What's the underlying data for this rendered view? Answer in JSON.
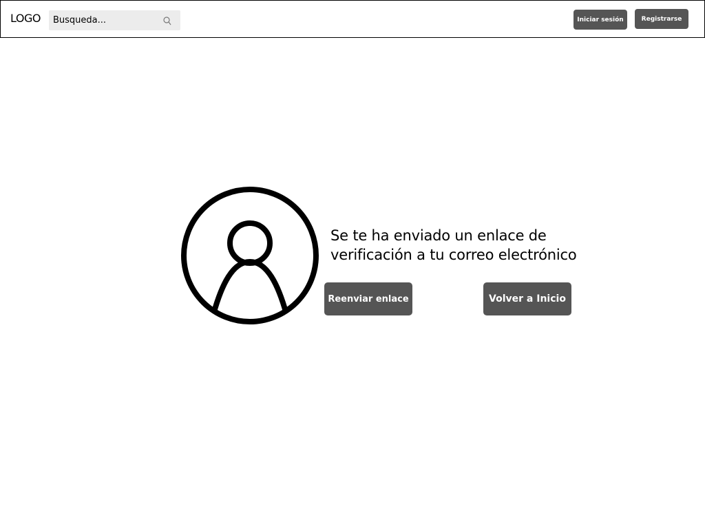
{
  "header": {
    "logo": "LOGO",
    "search": {
      "placeholder": "Busqueda...",
      "icon": "search-icon"
    },
    "login_label": "Iniciar sesión",
    "register_label": "Registrarse"
  },
  "main": {
    "avatar_icon": "user-avatar-icon",
    "message": "Se te ha enviado un enlace de verificación a tu correo electrónico",
    "resend_label": "Reenviar enlace",
    "home_label": "Volver a Inicio"
  },
  "colors": {
    "button_bg": "#555555",
    "button_text": "#ffffff",
    "search_bg": "#ececec",
    "border": "#000000"
  }
}
